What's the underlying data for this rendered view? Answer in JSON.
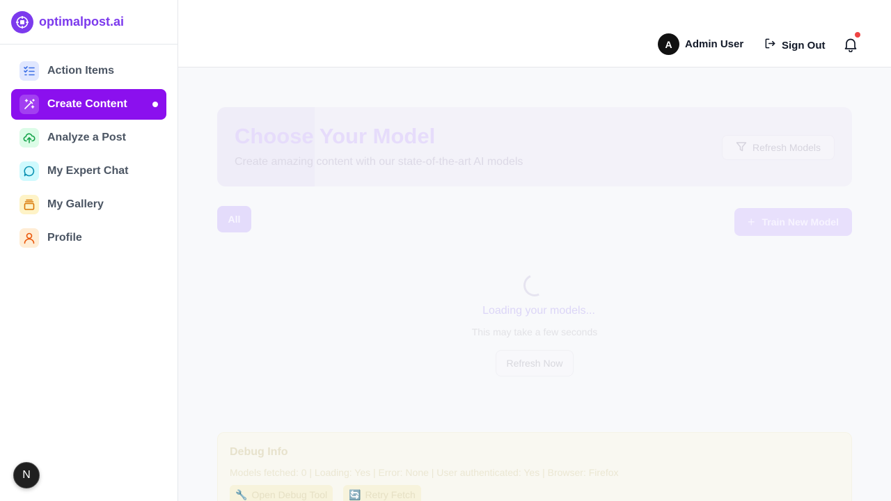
{
  "brand": {
    "name": "optimalpost.ai"
  },
  "sidebar": {
    "items": [
      {
        "label": "Action Items",
        "icon": "checklist-icon",
        "icon_bg": "#e0e7ff",
        "icon_color": "#3b6fe6"
      },
      {
        "label": "Create Content",
        "icon": "magic-wand-icon",
        "active": true
      },
      {
        "label": "Analyze a Post",
        "icon": "cloud-upload-icon",
        "icon_bg": "#dcfce7",
        "icon_color": "#16a34a"
      },
      {
        "label": "My Expert Chat",
        "icon": "chat-bubble-icon",
        "icon_bg": "#cffafe",
        "icon_color": "#0891b2"
      },
      {
        "label": "My Gallery",
        "icon": "gallery-stack-icon",
        "icon_bg": "#fef3c7",
        "icon_color": "#d97706"
      },
      {
        "label": "Profile",
        "icon": "user-icon",
        "icon_bg": "#ffedd5",
        "icon_color": "#ea580c"
      }
    ],
    "badge_letter": "N"
  },
  "header": {
    "avatar_letter": "A",
    "user_name": "Admin User",
    "sign_out_label": "Sign Out"
  },
  "main": {
    "title": "Choose Your Model",
    "subtitle": "Create amazing content with our state-of-the-art AI models",
    "refresh_models_label": "Refresh Models",
    "tabs": [
      {
        "label": "All"
      }
    ],
    "train_label": "Train New Model",
    "loading_text": "Loading your models...",
    "loading_sub": "This may take a few seconds",
    "refresh_now_label": "Refresh Now"
  },
  "debug": {
    "title": "Debug Info",
    "info": "Models fetched: 0 | Loading: Yes | Error: None | User authenticated: Yes | Browser: Firefox",
    "open_tool_label": "Open Debug Tool",
    "retry_label": "Retry Fetch"
  },
  "colors": {
    "accent": "#8b10ee",
    "brand": "#7c3aed",
    "notification": "#ef4444"
  }
}
